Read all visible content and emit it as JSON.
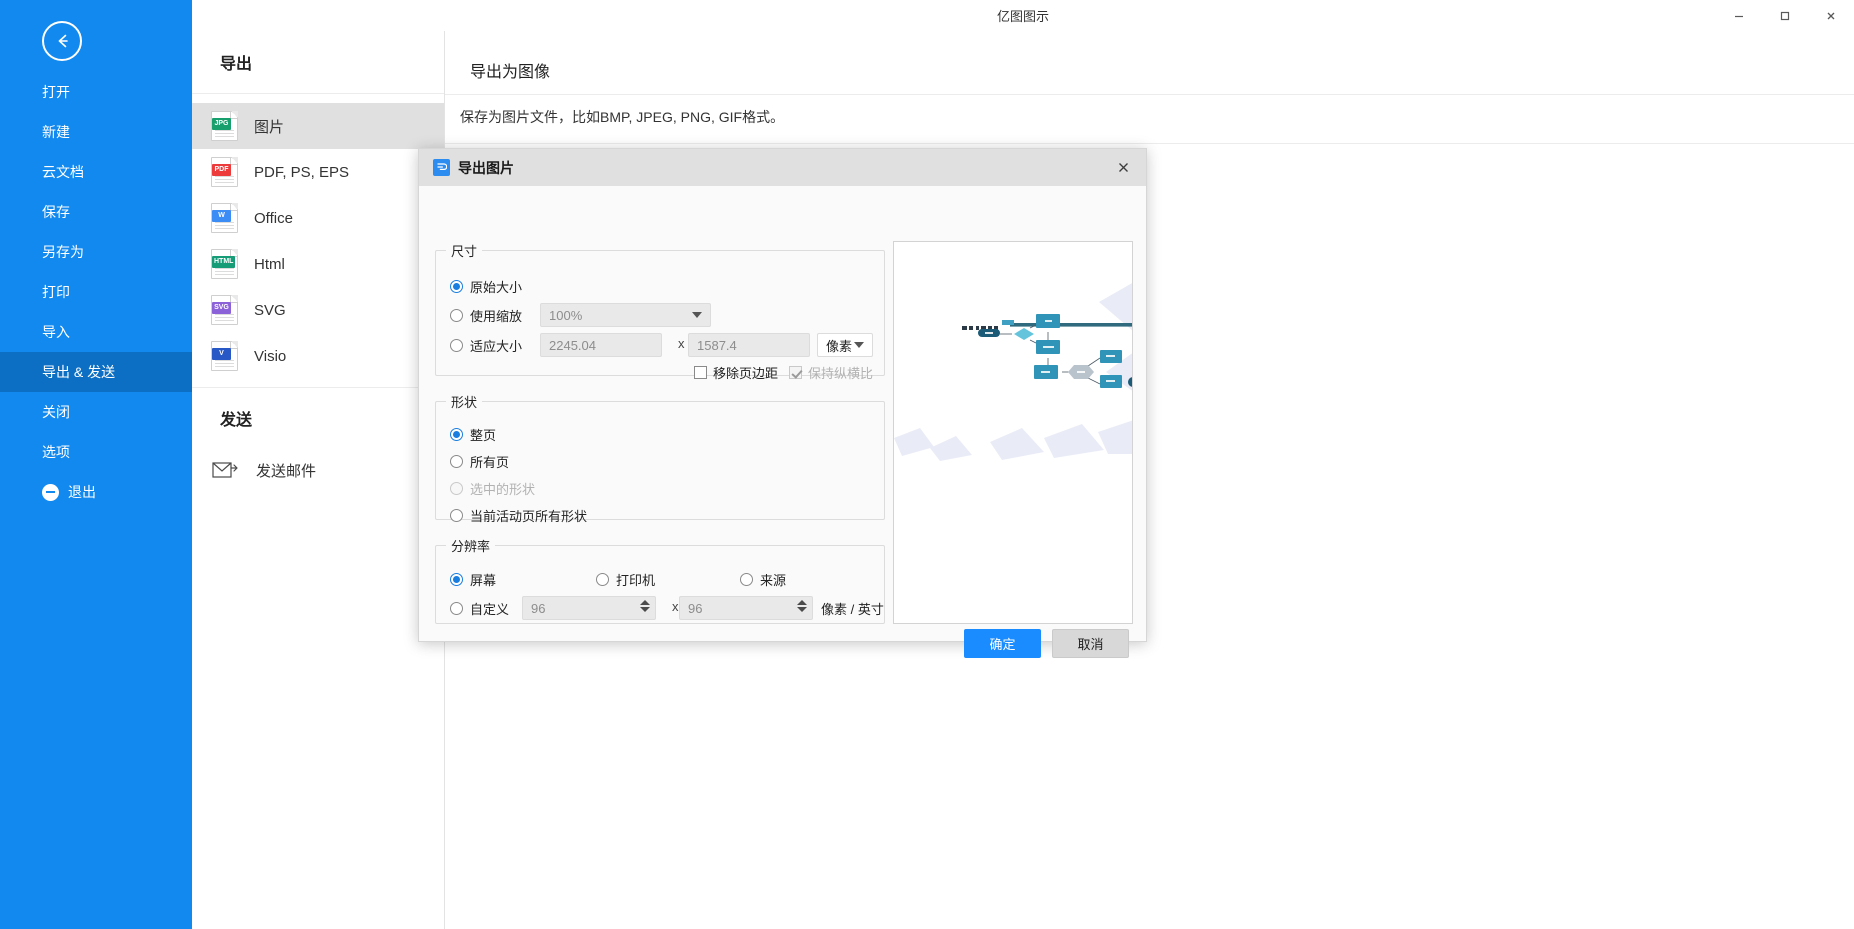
{
  "window": {
    "title": "亿图图示",
    "controls": {
      "minimize": "—",
      "maximize": "▢",
      "close": "✕"
    },
    "dots": "...",
    "icons": {
      "chat": "chat-icon",
      "vip": "vip-diamond-icon",
      "caret": "caret-down-icon"
    }
  },
  "sidebar": {
    "back_label": "back-arrow",
    "items": [
      {
        "label": "打开",
        "name": "open",
        "active": false
      },
      {
        "label": "新建",
        "name": "new",
        "active": false
      },
      {
        "label": "云文档",
        "name": "cloud-docs",
        "active": false
      },
      {
        "label": "保存",
        "name": "save",
        "active": false
      },
      {
        "label": "另存为",
        "name": "save-as",
        "active": false
      },
      {
        "label": "打印",
        "name": "print",
        "active": false
      },
      {
        "label": "导入",
        "name": "import",
        "active": false
      },
      {
        "label": "导出 & 发送",
        "name": "export-send",
        "active": true
      },
      {
        "label": "关闭",
        "name": "close",
        "active": false
      },
      {
        "label": "选项",
        "name": "options",
        "active": false
      },
      {
        "label": "退出",
        "name": "exit",
        "active": false
      }
    ]
  },
  "export_column": {
    "heading": "导出",
    "formats": [
      {
        "label": "图片",
        "tag": "JPG",
        "icon": "jpg-file-icon",
        "selected": true
      },
      {
        "label": "PDF, PS, EPS",
        "tag": "PDF",
        "icon": "pdf-file-icon",
        "selected": false
      },
      {
        "label": "Office",
        "tag": "W",
        "icon": "word-file-icon",
        "selected": false
      },
      {
        "label": "Html",
        "tag": "HTML",
        "icon": "html-file-icon",
        "selected": false
      },
      {
        "label": "SVG",
        "tag": "SVG",
        "icon": "svg-file-icon",
        "selected": false
      },
      {
        "label": "Visio",
        "tag": "V",
        "icon": "visio-file-icon",
        "selected": false
      }
    ],
    "send_heading": "发送",
    "send_item": {
      "label": "发送邮件",
      "icon": "mail-icon"
    }
  },
  "main": {
    "title": "导出为图像",
    "description": "保存为图片文件，比如BMP, JPEG, PNG, GIF格式。"
  },
  "dialog": {
    "title": "导出图片",
    "close_label": "✕",
    "size": {
      "legend": "尺寸",
      "original_label": "原始大小",
      "original_selected": true,
      "scale_label": "使用缩放",
      "scale_selected": false,
      "scale_value": "100%",
      "fit_label": "适应大小",
      "fit_selected": false,
      "width_value": "2245.04",
      "height_value": "1587.4",
      "x_separator": "x",
      "unit_value": "像素",
      "remove_margin_label": "移除页边距",
      "remove_margin_checked": false,
      "keep_ratio_label": "保持纵横比",
      "keep_ratio_checked": true,
      "keep_ratio_disabled": true
    },
    "shape": {
      "legend": "形状",
      "options": [
        {
          "label": "整页",
          "selected": true,
          "disabled": false
        },
        {
          "label": "所有页",
          "selected": false,
          "disabled": false
        },
        {
          "label": "选中的形状",
          "selected": false,
          "disabled": true
        },
        {
          "label": "当前活动页所有形状",
          "selected": false,
          "disabled": false
        }
      ]
    },
    "resolution": {
      "legend": "分辨率",
      "options": [
        {
          "label": "屏幕",
          "selected": true
        },
        {
          "label": "打印机",
          "selected": false
        },
        {
          "label": "来源",
          "selected": false
        }
      ],
      "custom_label": "自定义",
      "custom_selected": false,
      "dpi_x": "96",
      "dpi_y": "96",
      "x_separator": "x",
      "unit_suffix": "像素 / 英寸"
    },
    "buttons": {
      "ok": "确定",
      "cancel": "取消"
    },
    "preview": {
      "name": "export-preview"
    }
  },
  "colors": {
    "sidebar_blue": "#1289ef",
    "sidebar_active": "#0c6fc4",
    "primary": "#1a8cff",
    "dialog_header": "#e0e0e0"
  }
}
